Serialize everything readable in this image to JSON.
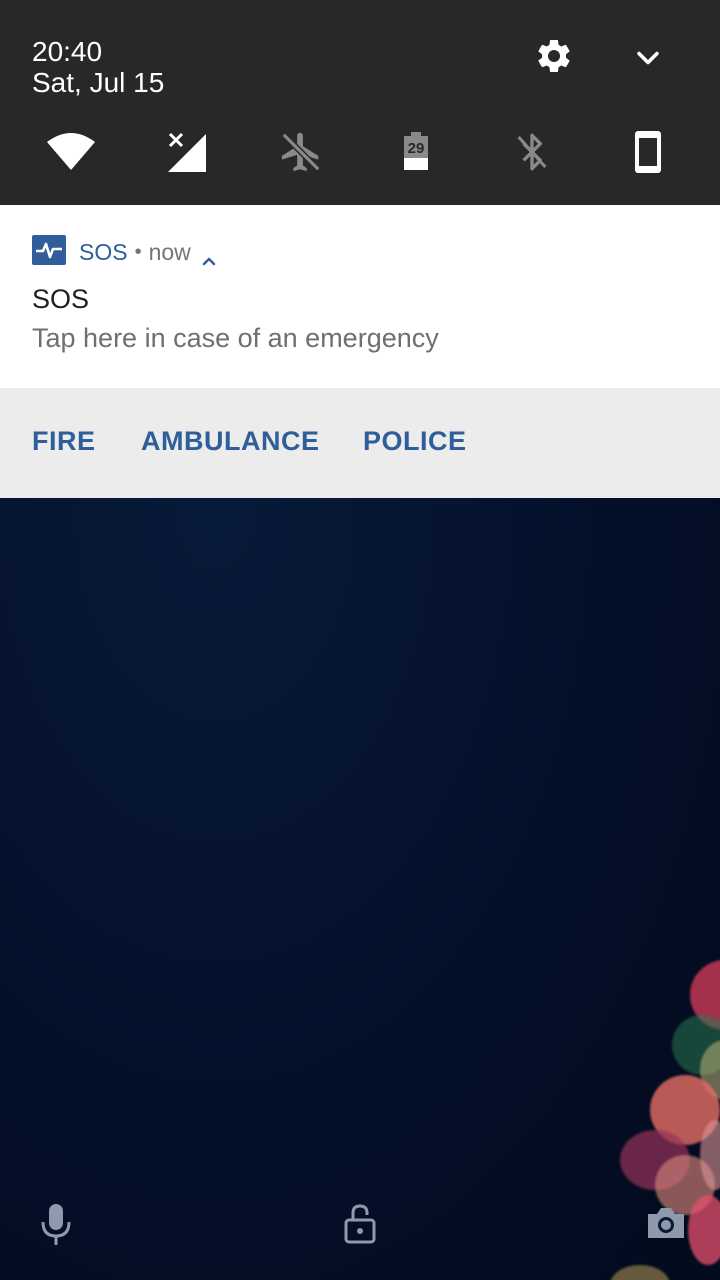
{
  "status": {
    "time": "20:40",
    "date": "Sat, Jul 15"
  },
  "quick_settings": {
    "settings_icon": "gear-icon",
    "expand_icon": "chevron-down-icon",
    "tiles": [
      {
        "name": "wifi-icon"
      },
      {
        "name": "cellular-no-signal-icon"
      },
      {
        "name": "airplane-mode-icon"
      },
      {
        "name": "battery-icon",
        "label": "29"
      },
      {
        "name": "bluetooth-icon"
      },
      {
        "name": "phone-rotation-icon"
      }
    ]
  },
  "notification": {
    "app_icon": "heartbeat-icon",
    "app_name": "SOS",
    "separator": "•",
    "time": "now",
    "title": "SOS",
    "text": "Tap here in case of an emergency",
    "actions": [
      "FIRE",
      "AMBULANCE",
      "POLICE"
    ]
  },
  "lock_shortcuts": {
    "left": "microphone-icon",
    "center": "unlock-icon",
    "right": "camera-icon"
  },
  "colors": {
    "accent": "#2f5e9a",
    "header_bg": "#282828",
    "actions_bg": "#ececec"
  }
}
